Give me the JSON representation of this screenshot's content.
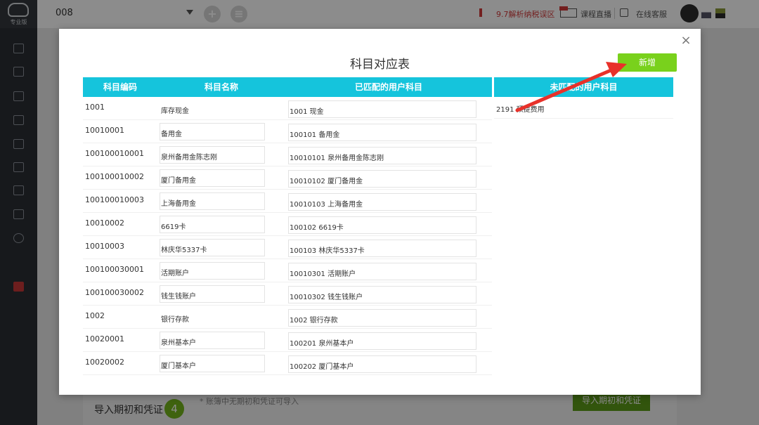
{
  "sidebar": {
    "logo_text": "专业版",
    "items": [
      "vouchers-icon",
      "money-icon",
      "report-icon",
      "ledger-icon",
      "invoice-icon",
      "tax-icon",
      "payroll-icon",
      "assets-icon",
      "settings-icon",
      "gift-icon"
    ]
  },
  "topbar": {
    "company": "008",
    "notice": "9.7解析纳税误区",
    "course_link": "课程直播",
    "service_link": "在线客服"
  },
  "background": {
    "step_title": "导入期初和凭证",
    "step_number": "4",
    "note": "* 账簿中无期初和凭证可导入",
    "import_button": "导入期初和凭证"
  },
  "modal": {
    "title": "科目对应表",
    "add_button": "新增",
    "close": "×",
    "headers": {
      "code": "科目编码",
      "name": "科目名称",
      "matched": "已匹配的用户科目",
      "unmatched": "未匹配的用户科目"
    },
    "rows": [
      {
        "code": "1001",
        "name": "库存现金",
        "matched": "1001 现金"
      },
      {
        "code": "10010001",
        "name": "备用金",
        "matched": "100101 备用金"
      },
      {
        "code": "100100010001",
        "name": "泉州备用金陈志刚",
        "matched": "10010101 泉州备用金陈志刚"
      },
      {
        "code": "100100010002",
        "name": "厦门备用金",
        "matched": "10010102 厦门备用金"
      },
      {
        "code": "100100010003",
        "name": "上海备用金",
        "matched": "10010103 上海备用金"
      },
      {
        "code": "10010002",
        "name": "6619卡",
        "matched": "100102 6619卡"
      },
      {
        "code": "10010003",
        "name": "林庆华5337卡",
        "matched": "100103 林庆华5337卡"
      },
      {
        "code": "100100030001",
        "name": "活期账户",
        "matched": "10010301 活期账户"
      },
      {
        "code": "100100030002",
        "name": "钱生钱账户",
        "matched": "10010302 钱生钱账户"
      },
      {
        "code": "1002",
        "name": "银行存款",
        "matched": "1002 银行存款"
      },
      {
        "code": "10020001",
        "name": "泉州基本户",
        "matched": "100201 泉州基本户"
      },
      {
        "code": "10020002",
        "name": "厦门基本户",
        "matched": "100202 厦门基本户"
      }
    ],
    "unmatched_items": [
      "2191 预提费用"
    ]
  },
  "colors": {
    "header_bg": "#15c4dc",
    "add_button": "#79d11c",
    "arrow": "#e8312a",
    "sidebar": "#2b2e33"
  }
}
